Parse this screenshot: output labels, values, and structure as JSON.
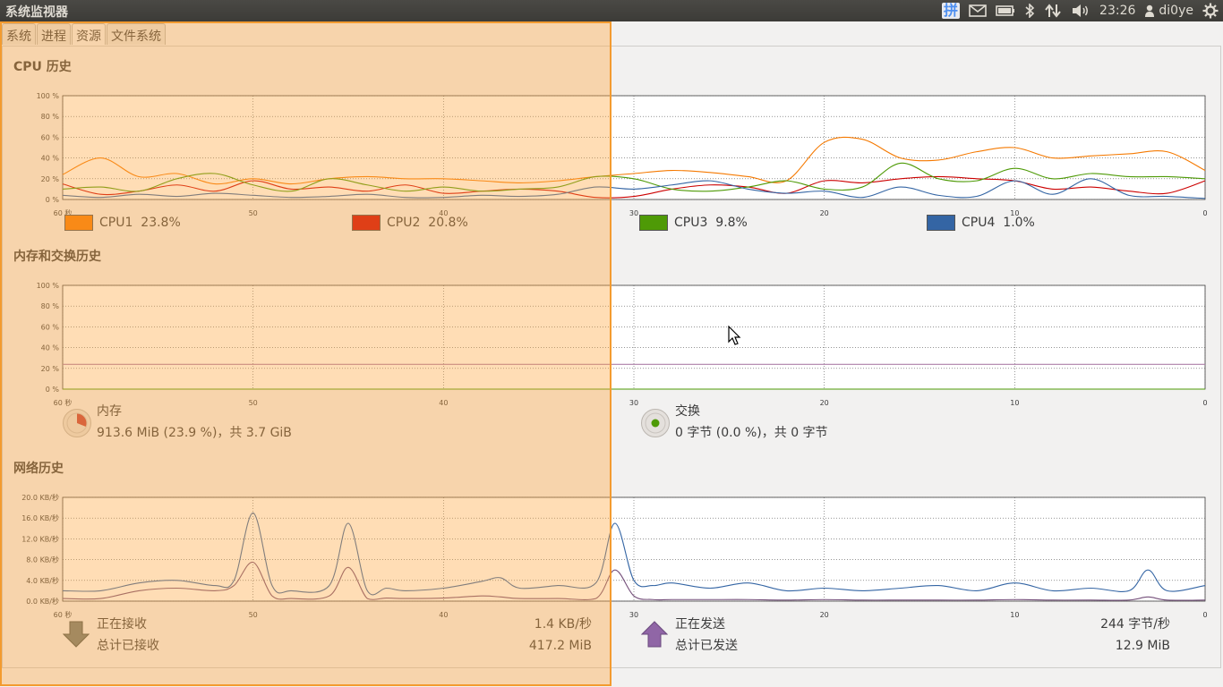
{
  "app": {
    "title": "系统监视器"
  },
  "tray": {
    "ime": "拼",
    "time": "23:26",
    "user": "di0ye"
  },
  "tabs": [
    {
      "label": "系统"
    },
    {
      "label": "进程"
    },
    {
      "label": "资源"
    },
    {
      "label": "文件系统"
    }
  ],
  "cpu": {
    "title": "CPU 历史",
    "y_ticks": [
      "100 %",
      "80 %",
      "60 %",
      "40 %",
      "20 %",
      "0 %"
    ],
    "x_ticks": [
      "60 秒",
      "50",
      "40",
      "30",
      "20",
      "10",
      "0"
    ],
    "legend": [
      {
        "label": "CPU1",
        "value": "23.8%",
        "color": "#f57900"
      },
      {
        "label": "CPU2",
        "value": "20.8%",
        "color": "#cc0000"
      },
      {
        "label": "CPU3",
        "value": "9.8%",
        "color": "#4e9a06"
      },
      {
        "label": "CPU4",
        "value": "1.0%",
        "color": "#3465a4"
      }
    ]
  },
  "memory": {
    "title": "内存和交换历史",
    "y_ticks": [
      "100 %",
      "80 %",
      "60 %",
      "40 %",
      "20 %",
      "0 %"
    ],
    "x_ticks": [
      "60 秒",
      "50",
      "40",
      "30",
      "20",
      "10",
      "0"
    ],
    "mem_label": "内存",
    "mem_value": "913.6 MiB (23.9 %)，共 3.7 GiB",
    "swap_label": "交换",
    "swap_value": "0 字节 (0.0 %)，共 0 字节",
    "mem_color": "#ad7fa8",
    "swap_color": "#4e9a06"
  },
  "network": {
    "title": "网络历史",
    "y_ticks": [
      "20.0 KB/秒",
      "16.0 KB/秒",
      "12.0 KB/秒",
      "8.0 KB/秒",
      "4.0 KB/秒",
      "0.0 KB/秒"
    ],
    "x_ticks": [
      "60 秒",
      "50",
      "40",
      "30",
      "20",
      "10",
      "0"
    ],
    "recv_label": "正在接收",
    "recv_total_label": "总计已接收",
    "recv_rate": "1.4 KB/秒",
    "recv_total": "417.2 MiB",
    "send_label": "正在发送",
    "send_total_label": "总计已发送",
    "send_rate": "244 字节/秒",
    "send_total": "12.9 MiB",
    "recv_color": "#3465a4",
    "send_color": "#75507b"
  },
  "chart_data": [
    {
      "type": "line",
      "title": "CPU 历史",
      "ylim": [
        0,
        100
      ],
      "x": [
        60,
        58,
        56,
        54,
        52,
        50,
        48,
        46,
        44,
        42,
        40,
        38,
        36,
        34,
        32,
        30,
        28,
        26,
        24,
        22,
        20,
        18,
        16,
        14,
        12,
        10,
        8,
        6,
        4,
        2,
        0
      ],
      "series": [
        {
          "name": "CPU1",
          "color": "#f57900",
          "values": [
            24,
            40,
            22,
            25,
            15,
            20,
            15,
            20,
            22,
            20,
            20,
            18,
            16,
            18,
            22,
            25,
            28,
            26,
            22,
            18,
            55,
            58,
            40,
            38,
            46,
            50,
            40,
            42,
            44,
            46,
            28
          ]
        },
        {
          "name": "CPU2",
          "color": "#cc0000",
          "values": [
            15,
            5,
            8,
            14,
            8,
            18,
            10,
            12,
            8,
            14,
            6,
            8,
            10,
            8,
            2,
            3,
            10,
            14,
            12,
            6,
            18,
            16,
            20,
            22,
            20,
            18,
            10,
            12,
            8,
            6,
            18
          ]
        },
        {
          "name": "CPU3",
          "color": "#4e9a06",
          "values": [
            10,
            12,
            8,
            20,
            25,
            14,
            8,
            20,
            14,
            8,
            12,
            8,
            10,
            12,
            22,
            20,
            10,
            8,
            12,
            18,
            10,
            12,
            35,
            20,
            18,
            30,
            20,
            25,
            22,
            22,
            20
          ]
        },
        {
          "name": "CPU4",
          "color": "#3465a4",
          "values": [
            4,
            2,
            5,
            3,
            6,
            4,
            2,
            3,
            5,
            2,
            2,
            4,
            3,
            5,
            12,
            10,
            14,
            18,
            10,
            6,
            8,
            2,
            12,
            4,
            3,
            18,
            5,
            20,
            4,
            3,
            1
          ]
        }
      ]
    },
    {
      "type": "line",
      "title": "内存和交换历史",
      "ylim": [
        0,
        100
      ],
      "x": [
        60,
        0
      ],
      "series": [
        {
          "name": "内存",
          "color": "#ad7fa8",
          "values": [
            23.9,
            23.9
          ]
        },
        {
          "name": "交换",
          "color": "#4e9a06",
          "values": [
            0,
            0
          ]
        }
      ]
    },
    {
      "type": "line",
      "title": "网络历史",
      "ylim": [
        0,
        20
      ],
      "x": [
        60,
        58,
        56,
        54,
        52,
        51,
        50,
        49,
        48,
        46,
        45,
        44,
        43,
        42,
        40,
        38,
        37,
        36,
        34,
        32,
        31,
        30,
        29,
        28,
        26,
        24,
        22,
        20,
        18,
        16,
        14,
        12,
        10,
        8,
        6,
        4,
        3,
        2,
        0
      ],
      "series": [
        {
          "name": "正在接收",
          "color": "#3465a4",
          "values": [
            2,
            2,
            3.5,
            4,
            3,
            4,
            17,
            3,
            2,
            3,
            15,
            2,
            2.5,
            2,
            2.5,
            3.8,
            4.5,
            2.5,
            3,
            3.5,
            15,
            4,
            3,
            3.5,
            2.5,
            3.5,
            2,
            2.5,
            2,
            2.5,
            3,
            2,
            3.5,
            2,
            2.5,
            2,
            6,
            2,
            3
          ]
        },
        {
          "name": "正在发送",
          "color": "#75507b",
          "values": [
            0.5,
            0.5,
            2,
            2.5,
            2,
            3,
            7.5,
            1,
            0.5,
            1,
            6.5,
            0.5,
            0.6,
            0.5,
            0.6,
            1,
            0.8,
            0.5,
            0.5,
            0.5,
            6,
            1,
            0.3,
            0.3,
            0.3,
            0.3,
            0.2,
            0.3,
            0.2,
            0.2,
            0.2,
            0.2,
            0.3,
            0.2,
            0.2,
            0.2,
            0.8,
            0.2,
            0.2
          ]
        }
      ]
    }
  ]
}
